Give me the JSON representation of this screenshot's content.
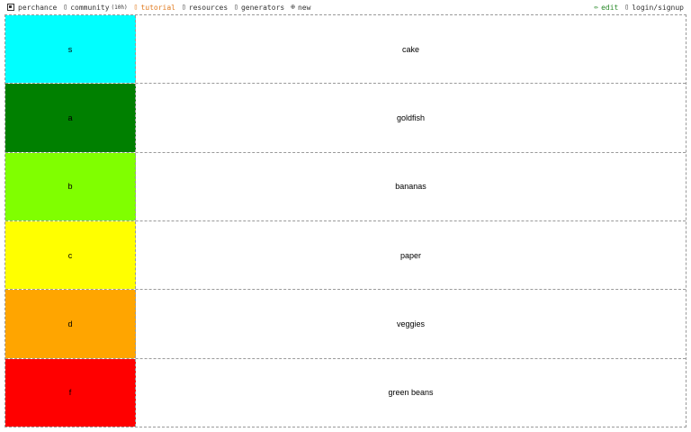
{
  "nav": {
    "brand": "perchance",
    "community": "community",
    "community_suffix": "(10h)",
    "tutorial": "tutorial",
    "resources": "resources",
    "generators": "generators",
    "new": "new",
    "edit": "edit",
    "login": "login/signup"
  },
  "icons": {
    "brand": "logo-icon",
    "community": "chat-icon",
    "tutorial": "book-icon",
    "resources": "link-icon",
    "generators": "grid-icon",
    "new": "plus-circle-icon",
    "edit": "pencil-icon",
    "login": "user-icon"
  },
  "tiers": [
    {
      "label": "s",
      "item": "cake",
      "color": "#00ffff"
    },
    {
      "label": "a",
      "item": "goldfish",
      "color": "#008000"
    },
    {
      "label": "b",
      "item": "bananas",
      "color": "#80ff00"
    },
    {
      "label": "c",
      "item": "paper",
      "color": "#ffff00"
    },
    {
      "label": "d",
      "item": "veggies",
      "color": "#ffa500"
    },
    {
      "label": "f",
      "item": "green beans",
      "color": "#ff0000"
    }
  ]
}
